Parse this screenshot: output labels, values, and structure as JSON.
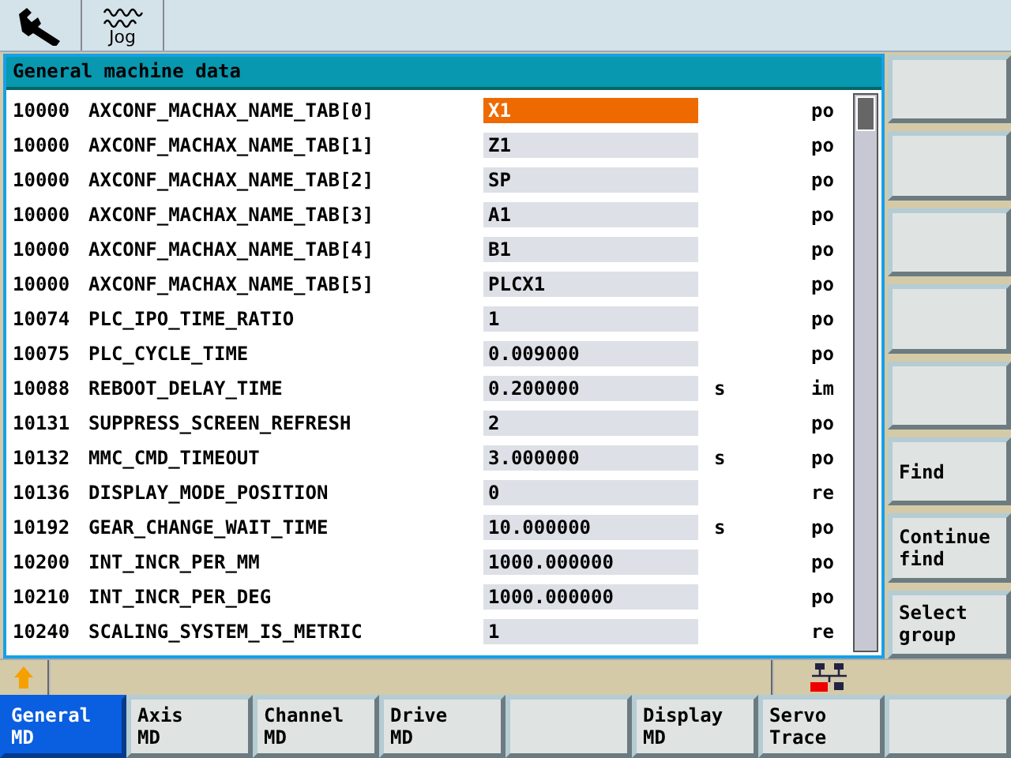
{
  "top_bar": {
    "buttons": [
      {
        "kind": "wrench"
      },
      {
        "kind": "jog",
        "label": "Jog"
      }
    ]
  },
  "panel": {
    "title": "General machine data",
    "rows": [
      {
        "number": "10000",
        "name": "AXCONF_MACHAX_NAME_TAB[0]",
        "value": "X1",
        "unit": "",
        "type": "po",
        "selected": true
      },
      {
        "number": "10000",
        "name": "AXCONF_MACHAX_NAME_TAB[1]",
        "value": "Z1",
        "unit": "",
        "type": "po",
        "selected": false
      },
      {
        "number": "10000",
        "name": "AXCONF_MACHAX_NAME_TAB[2]",
        "value": "SP",
        "unit": "",
        "type": "po",
        "selected": false
      },
      {
        "number": "10000",
        "name": "AXCONF_MACHAX_NAME_TAB[3]",
        "value": "A1",
        "unit": "",
        "type": "po",
        "selected": false
      },
      {
        "number": "10000",
        "name": "AXCONF_MACHAX_NAME_TAB[4]",
        "value": "B1",
        "unit": "",
        "type": "po",
        "selected": false
      },
      {
        "number": "10000",
        "name": "AXCONF_MACHAX_NAME_TAB[5]",
        "value": "PLCX1",
        "unit": "",
        "type": "po",
        "selected": false
      },
      {
        "number": "10074",
        "name": "PLC_IPO_TIME_RATIO",
        "value": "1",
        "unit": "",
        "type": "po",
        "selected": false
      },
      {
        "number": "10075",
        "name": "PLC_CYCLE_TIME",
        "value": "0.009000",
        "unit": "",
        "type": "po",
        "selected": false
      },
      {
        "number": "10088",
        "name": "REBOOT_DELAY_TIME",
        "value": "0.200000",
        "unit": "s",
        "type": "im",
        "selected": false
      },
      {
        "number": "10131",
        "name": "SUPPRESS_SCREEN_REFRESH",
        "value": "2",
        "unit": "",
        "type": "po",
        "selected": false
      },
      {
        "number": "10132",
        "name": "MMC_CMD_TIMEOUT",
        "value": "3.000000",
        "unit": "s",
        "type": "po",
        "selected": false
      },
      {
        "number": "10136",
        "name": "DISPLAY_MODE_POSITION",
        "value": "0",
        "unit": "",
        "type": "re",
        "selected": false
      },
      {
        "number": "10192",
        "name": "GEAR_CHANGE_WAIT_TIME",
        "value": "10.000000",
        "unit": "s",
        "type": "po",
        "selected": false
      },
      {
        "number": "10200",
        "name": "INT_INCR_PER_MM",
        "value": "1000.000000",
        "unit": "",
        "type": "po",
        "selected": false
      },
      {
        "number": "10210",
        "name": "INT_INCR_PER_DEG",
        "value": "1000.000000",
        "unit": "",
        "type": "po",
        "selected": false
      },
      {
        "number": "10240",
        "name": "SCALING_SYSTEM_IS_METRIC",
        "value": "1",
        "unit": "",
        "type": "re",
        "selected": false
      }
    ]
  },
  "side_softkeys": [
    {
      "kind": "blank"
    },
    {
      "kind": "blank"
    },
    {
      "kind": "blank"
    },
    {
      "kind": "blank"
    },
    {
      "kind": "blank"
    },
    {
      "kind": "text",
      "label": "Find"
    },
    {
      "kind": "text",
      "label": "Continue\nfind"
    },
    {
      "kind": "text",
      "label": "Select\ngroup"
    }
  ],
  "bottom_softkeys": [
    {
      "label": "General\nMD",
      "selected": true
    },
    {
      "label": "Axis\nMD",
      "selected": false
    },
    {
      "label": "Channel\nMD",
      "selected": false
    },
    {
      "label": "Drive\nMD",
      "selected": false
    },
    {
      "selected": false
    },
    {
      "label": "Display\nMD",
      "selected": false
    },
    {
      "label": "Servo\nTrace",
      "selected": false
    },
    {
      "selected": false
    }
  ]
}
